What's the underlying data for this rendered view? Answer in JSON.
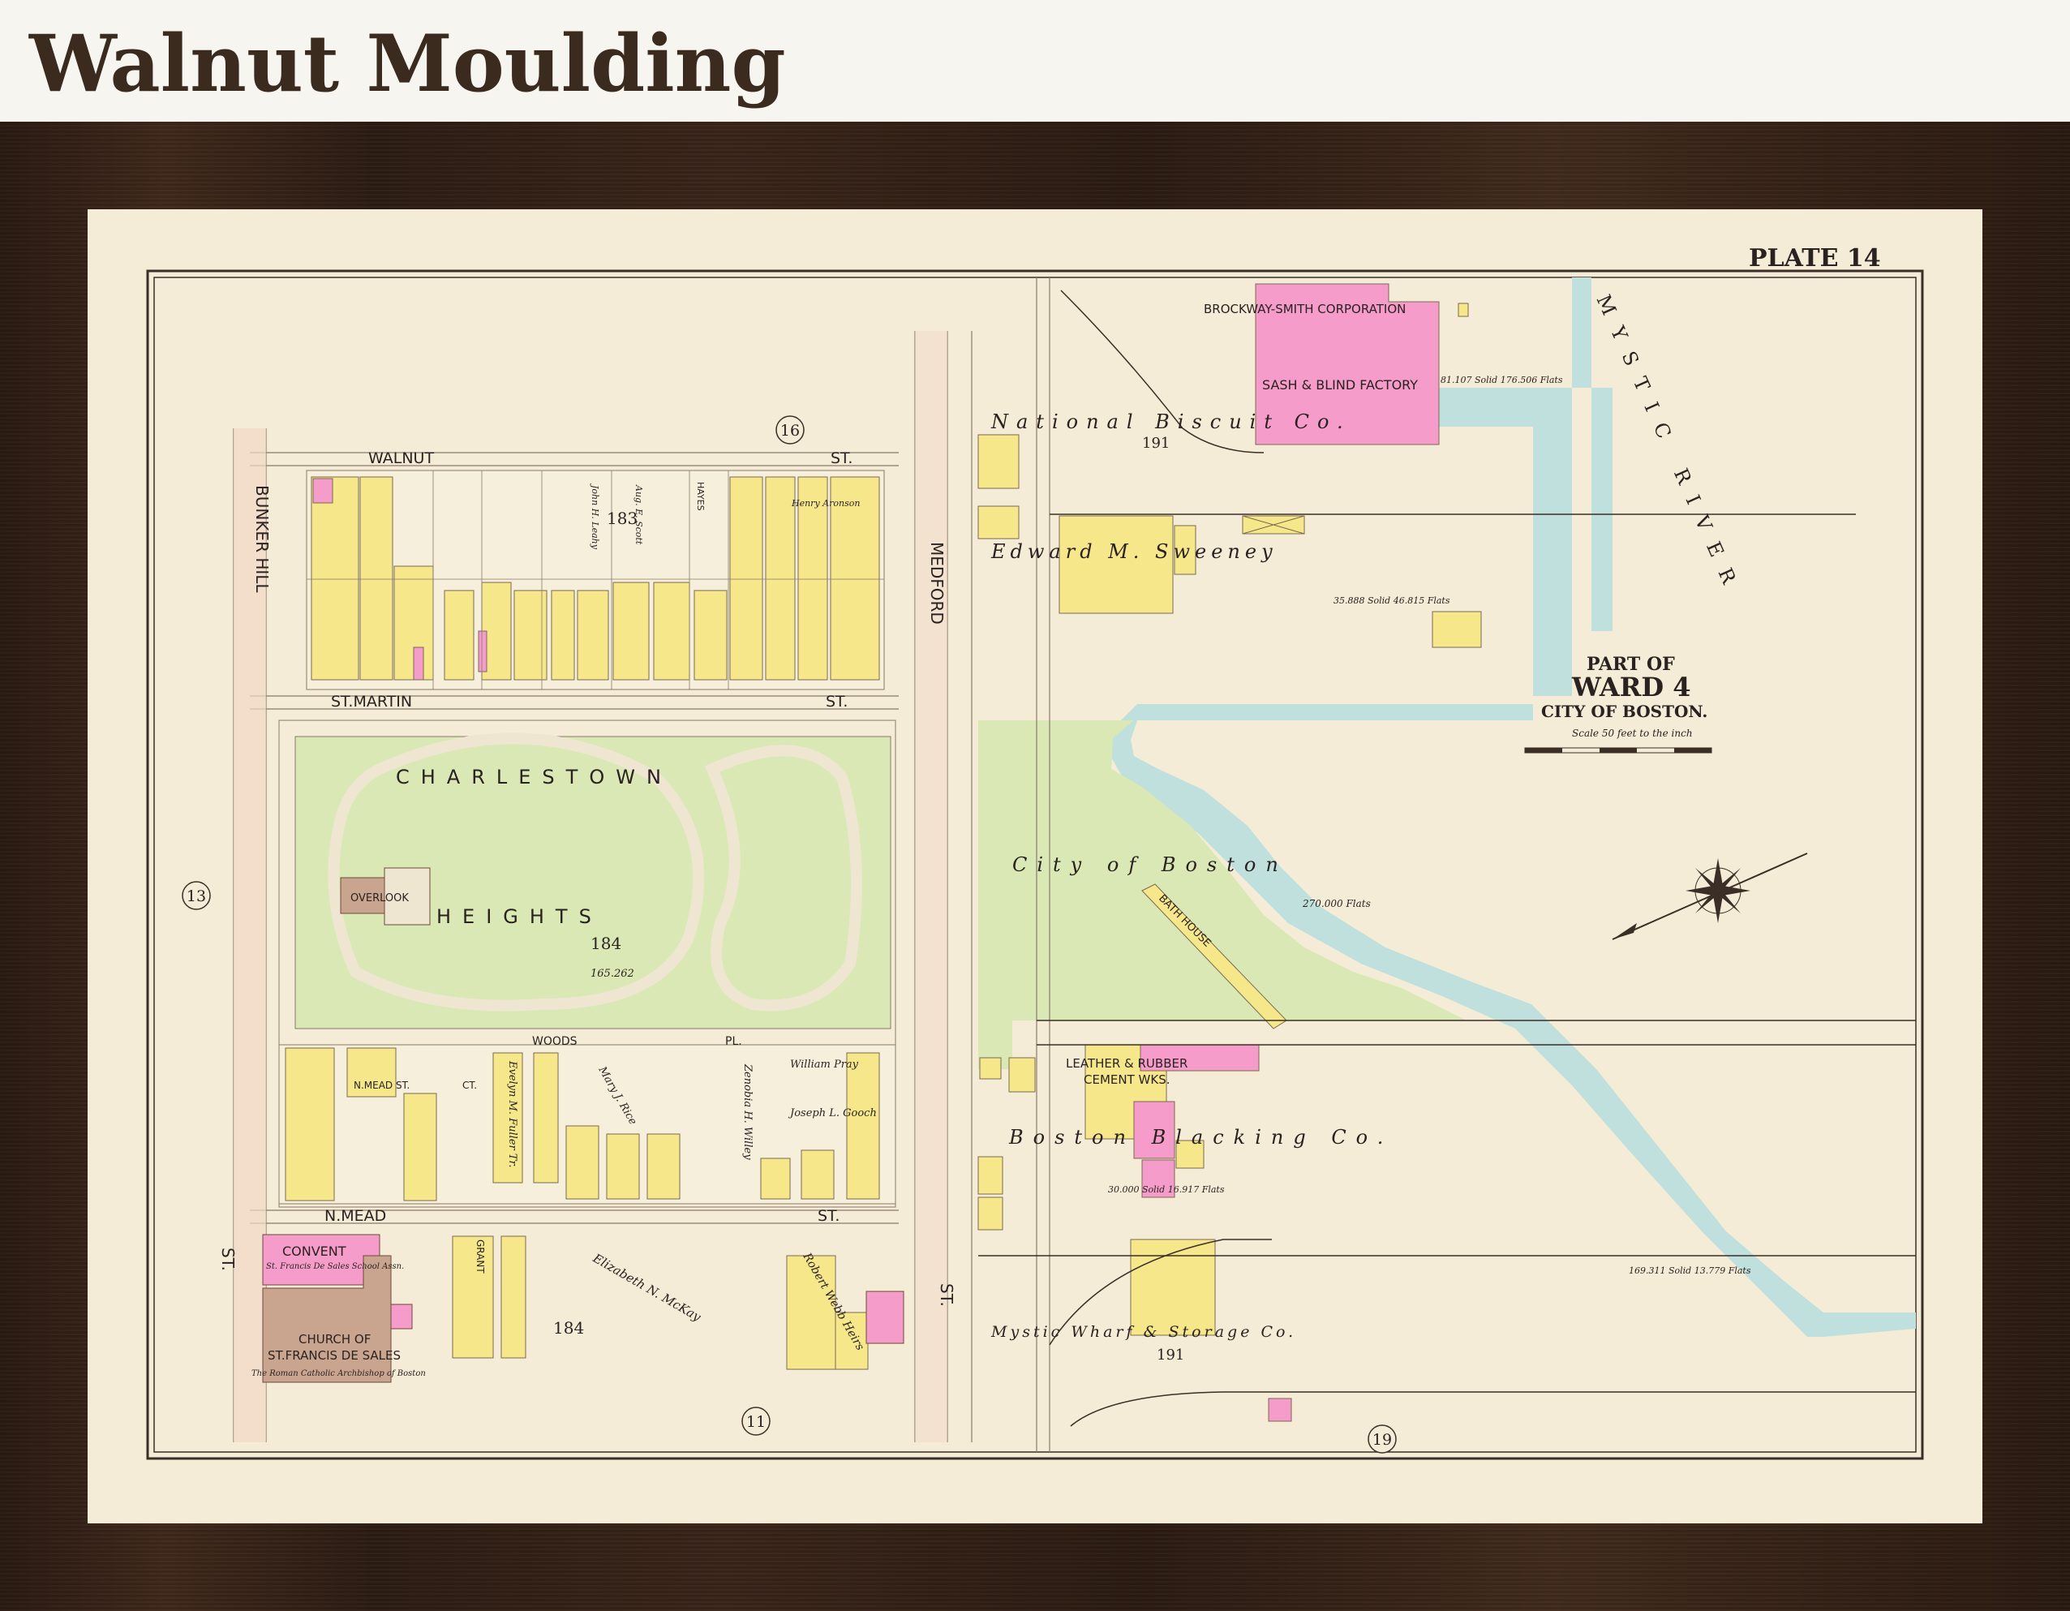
{
  "header": {
    "title": "Walnut Moulding"
  },
  "map": {
    "plate_label": "PLATE 14",
    "ward": {
      "part_of": "PART OF",
      "ward": "WARD 4",
      "city": "CITY OF BOSTON.",
      "scale": "Scale 50 feet to the inch"
    },
    "colors": {
      "frame": "#3a2519",
      "paper": "#f4ecd6",
      "yellow": "#f6e88a",
      "pink": "#f59ccb",
      "green": "#d9e8b4",
      "water": "#bfe0dc",
      "brick": "#c9a58f"
    },
    "streets": {
      "walnut": "WALNUT",
      "walnut_st": "ST.",
      "st_martin": "ST.MARTIN",
      "st_martin_st": "ST.",
      "bunker_hill": "BUNKER HILL",
      "bunker_hill_st": "ST.",
      "medford": "MEDFORD",
      "medford_st": "ST.",
      "n_mead": "N.MEAD",
      "n_mead_st": "ST.",
      "woods_pl": "WOODS",
      "woods_pl2": "PL.",
      "n_mead_ct": "N.MEAD ST.",
      "n_mead_ct2": "CT.",
      "grant": "GRANT"
    },
    "plate_refs": {
      "top": "16",
      "left": "13",
      "bottom_left": "11",
      "bottom_right": "19"
    },
    "blocks": {
      "b183": "183",
      "b184a": "184",
      "b184b": "184",
      "b191a": "191",
      "b191b": "191"
    },
    "park": {
      "line1": "CHARLESTOWN",
      "line2": "HEIGHTS",
      "number": "184",
      "area": "165.262",
      "overlook": "OVERLOOK"
    },
    "labels": {
      "national_biscuit": "National   Biscuit   Co.",
      "brockway": "BROCKWAY-SMITH CORPORATION",
      "sash": "SASH & BLIND FACTORY",
      "sweeney": "Edward   M.   Sweeney",
      "city_of_boston": "City   of   Boston",
      "bath_house": "BATH HOUSE",
      "mystic_river": "MYSTIC   RIVER",
      "leather": "LEATHER & RUBBER",
      "cement": "CEMENT WKS.",
      "blacking": "Boston   Blacking   Co.",
      "mystic_wharf": "Mystic Wharf & Storage Co.",
      "convent": "CONVENT",
      "convent_sub": "St. Francis De Sales School Assn.",
      "church1": "CHURCH OF",
      "church2": "ST.FRANCIS DE SALES",
      "church_owner": "The Roman Catholic Archbishop of Boston",
      "elizabeth": "Elizabeth N. McKay",
      "robert": "Robert Webb Heirs",
      "william_pray": "William Pray",
      "joseph_gooch": "Joseph L. Gooch",
      "evelyn": "Evelyn M. Fuller Tr.",
      "mary_rice": "Mary J. Rice",
      "zenobia": "Zenobia H. Willey",
      "john_leahy": "John H. Leahy",
      "aug_scott": "Aug. E. Scott",
      "henry_aronson": "Henry Aronson",
      "hayes": "HAYES"
    },
    "areas": {
      "biscuit_area": "81.107 Solid 176.506 Flats",
      "sweeney_area": "35.888 Solid 46.815 Flats",
      "city_area": "270.000 Flats",
      "blacking_area": "30.000 Solid 16.917 Flats",
      "wharf_area": "169.311 Solid 13.779 Flats"
    }
  }
}
